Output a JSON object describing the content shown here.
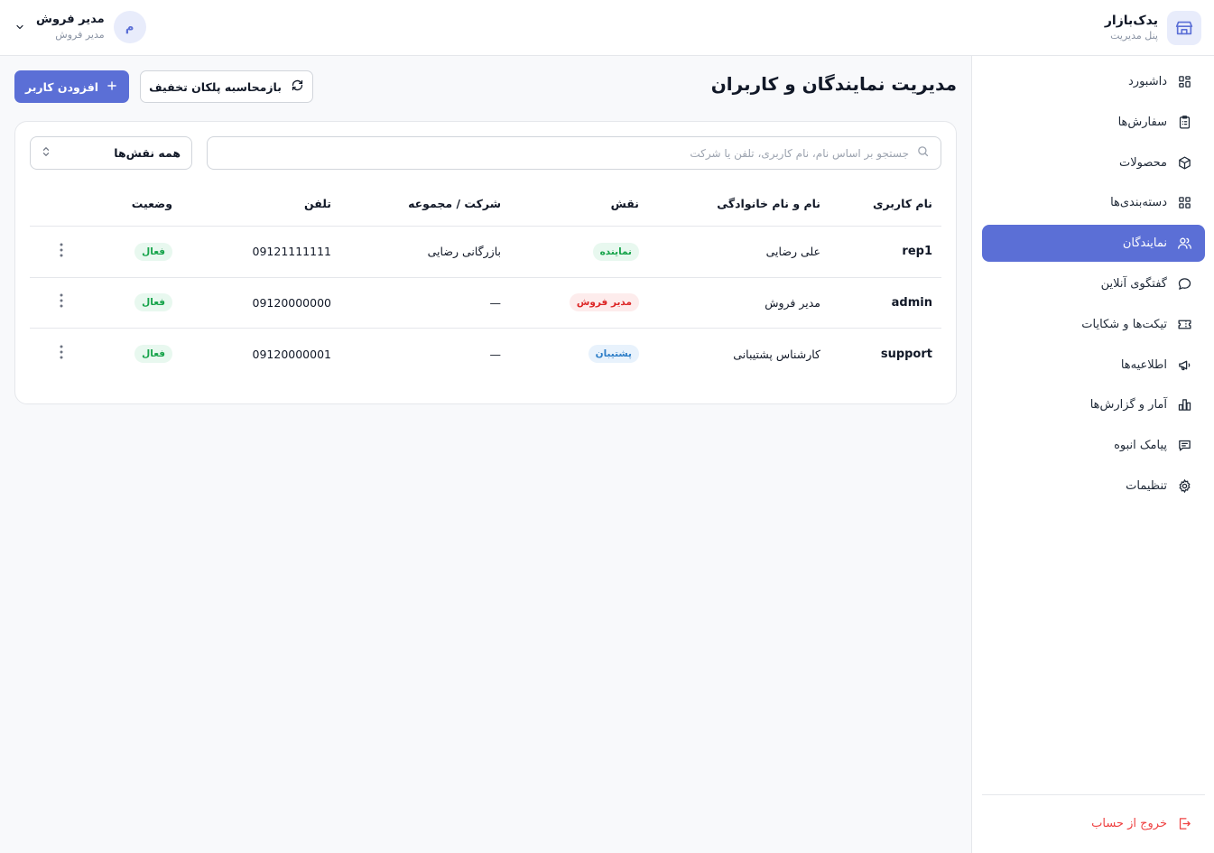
{
  "brand": {
    "title": "یدک‌بازار",
    "subtitle": "پنل مدیریت"
  },
  "user": {
    "name": "مدیر فروش",
    "role": "مدیر فروش",
    "avatar_initial": "م"
  },
  "sidebar": {
    "items": [
      {
        "label": "داشبورد",
        "icon": "dashboard-grid-icon",
        "active": false
      },
      {
        "label": "سفارش‌ها",
        "icon": "clipboard-icon",
        "active": false
      },
      {
        "label": "محصولات",
        "icon": "box-icon",
        "active": false
      },
      {
        "label": "دسته‌بندی‌ها",
        "icon": "categories-grid-icon",
        "active": false
      },
      {
        "label": "نمایندگان",
        "icon": "users-icon",
        "active": true
      },
      {
        "label": "گفتگوی آنلاین",
        "icon": "chat-bubble-icon",
        "active": false
      },
      {
        "label": "تیکت‌ها و شکایات",
        "icon": "ticket-icon",
        "active": false
      },
      {
        "label": "اطلاعیه‌ها",
        "icon": "megaphone-icon",
        "active": false
      },
      {
        "label": "آمار و گزارش‌ها",
        "icon": "bar-chart-icon",
        "active": false
      },
      {
        "label": "پیامک انبوه",
        "icon": "message-icon",
        "active": false
      },
      {
        "label": "تنظیمات",
        "icon": "gear-icon",
        "active": false
      }
    ],
    "logout_label": "خروج از حساب"
  },
  "page": {
    "title": "مدیریت نمایندگان و کاربران",
    "add_button": "افزودن کاربر",
    "recalc_button": "بازمحاسبه پلکان تخفیف"
  },
  "filters": {
    "search_placeholder": "جستجو بر اساس نام، نام کاربری، تلفن یا شرکت",
    "search_value": "",
    "role_selected": "همه نقش‌ها"
  },
  "table": {
    "headers": {
      "username": "نام کاربری",
      "fullname": "نام و نام خانوادگی",
      "role": "نقش",
      "company": "شرکت / مجموعه",
      "phone": "تلفن",
      "status": "وضعیت"
    },
    "rows": [
      {
        "username": "rep1",
        "fullname": "علی رضایی",
        "role": "نماینده",
        "company": "بازرگانی رضایی",
        "phone": "09121111111",
        "status": "فعال"
      },
      {
        "username": "admin",
        "fullname": "مدیر فروش",
        "role": "مدیر فروش",
        "company": "—",
        "phone": "09120000000",
        "status": "فعال"
      },
      {
        "username": "support",
        "fullname": "کارشناس پشتیبانی",
        "role": "پشتیبان",
        "company": "—",
        "phone": "09120000001",
        "status": "فعال"
      }
    ]
  },
  "colors": {
    "accent": "#5b6fd6",
    "success": "#16a34a",
    "danger": "#dc2626",
    "info": "#2f7fc8",
    "logout": "#ef4444"
  }
}
